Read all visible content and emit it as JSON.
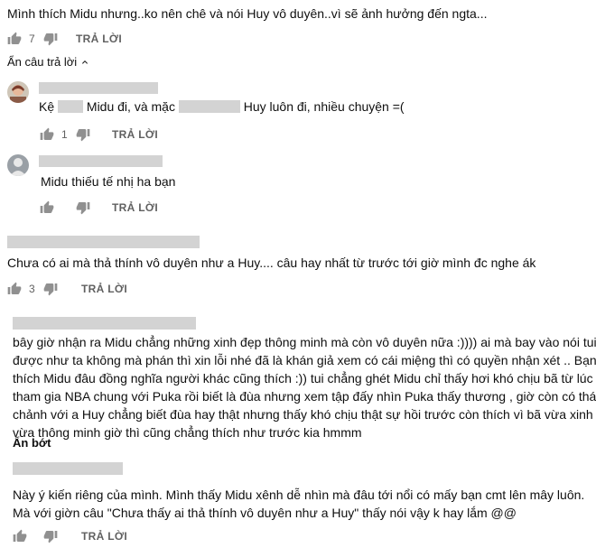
{
  "comments": {
    "c0": {
      "text": "Mình thích Midu nhưng..ko nên chê và nói Huy vô duyên..vì sẽ ảnh hưởng đến ngta...",
      "likes": "7",
      "reply": "TRẢ LỜI"
    },
    "hide_replies": "Ẩn câu trả lời",
    "r1": {
      "text_a": "Kệ",
      "text_b": "Midu đi, và mặc",
      "text_c": "Huy luôn đi, nhiều chuyện =(",
      "likes": "1",
      "reply": "TRẢ LỜI"
    },
    "r2": {
      "text": "Midu thiếu tế nhị ha bạn",
      "reply": "TRẢ LỜI"
    },
    "c3": {
      "text": "Chưa có ai mà thả thính vô duyên như a Huy.... câu hay nhất từ trước tới giờ mình đc nghe ák",
      "likes": "3",
      "reply": "TRẢ LỜI"
    },
    "c4": {
      "lines": [
        "bây giờ nhận ra Midu chẳng những xinh đẹp thông minh mà còn vô duyên nữa :)))) ai mà bay vào nói tui làm",
        "được như ta không mà phán thì xin lỗi nhé đã là khán giả xem có cái miệng thì có quyền nhận xét .. Bạn",
        "thích Midu đâu đồng nghĩa người khác cũng thích :)) tui chẳng ghét Midu chỉ thấy hơi khó chịu bã từ lúc",
        "tham gia NBA chung với Puka rồi biết là đùa nhưng xem tập đấy nhìn Puka thấy thương , giờ còn có thái độ",
        "chảnh với a Huy chẳng biết đùa hay thật nhưng thấy khó chịu thật sự hồi trước còn thích vì bã vừa xinh đẹp",
        "vừa thông minh giờ thì cũng chẳng thích như trước kia hmmm"
      ],
      "show_less": "Ẩn bớt"
    },
    "c5": {
      "lines": [
        "Này ý kiến riêng của mình. Mình thấy Midu xênh dễ nhìn mà đâu tới nổi có mấy bạn cmt lên mây luôn.",
        "Mà với giờn câu \"Chưa thấy ai thả thính vô duyên như a Huy\" thấy nói vậy k hay lắm @@"
      ],
      "reply": "TRẢ LỜI"
    }
  },
  "colors": {
    "text": "#0f0f0f",
    "secondary": "#606060",
    "icon": "#909090",
    "redact": "#d3d3d3"
  },
  "icons": {
    "like": "thumbs-up-icon",
    "dislike": "thumbs-down-icon",
    "chevron": "chevron-up-icon"
  }
}
